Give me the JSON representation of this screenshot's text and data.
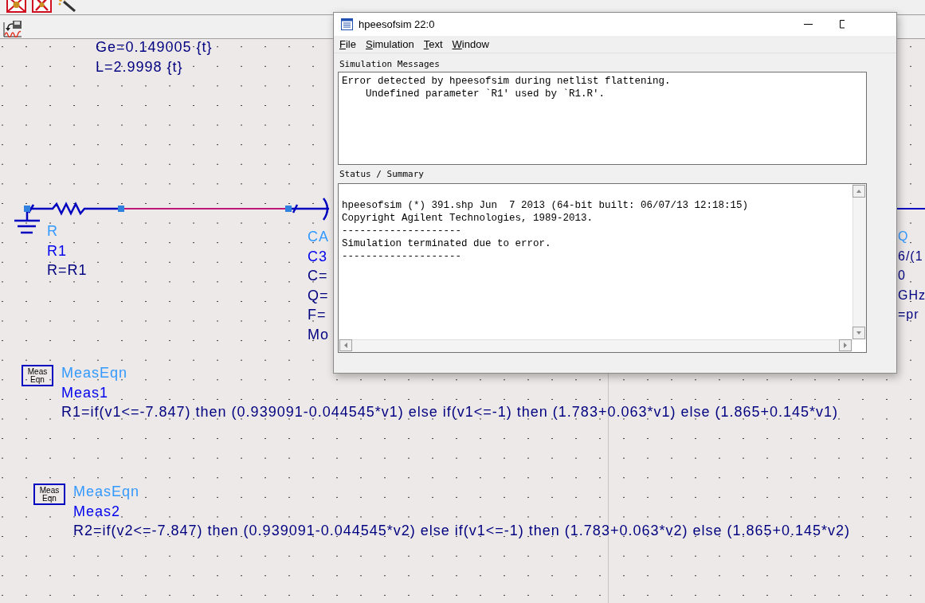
{
  "schematic": {
    "top_params": [
      "Ge=0.149005 {t}",
      "L=2.9998 {t}"
    ],
    "components": [
      {
        "type_label": "R",
        "name": "R1",
        "params": [
          "R=R1"
        ]
      },
      {
        "type_label": "CA",
        "name": "C3",
        "params": [
          "C=",
          "Q=",
          "F=",
          "Mo"
        ]
      },
      {
        "type_label": "Q",
        "params": [
          "6/(1",
          "0",
          "GHz",
          "=pr"
        ]
      }
    ],
    "equations": [
      {
        "icon_lines": [
          "Meas",
          "Eqn"
        ],
        "type_label": "MeasEqn",
        "name": "Meas1",
        "expression": "R1=if(v1<=-7.847) then (0.939091-0.044545*v1) else if(v1<=-1) then (1.783+0.063*v1) else (1.865+0.145*v1)"
      },
      {
        "icon_lines": [
          "Meas",
          "Eqn"
        ],
        "type_label": "MeasEqn",
        "name": "Meas2",
        "expression": "R2=if(v2<=-7.847) then (0.939091-0.044545*v2) else if(v1<=-1) then (1.783+0.063*v2) else (1.865+0.145*v2)"
      }
    ]
  },
  "window": {
    "title": "hpeesofsim 22:0",
    "menu": [
      "File",
      "Simulation",
      "Text",
      "Window"
    ],
    "messages_label": "Simulation Messages",
    "messages": [
      "Error detected by hpeesofsim during netlist flattening.",
      "    Undefined parameter `R1' used by `R1.R'."
    ],
    "status_label": "Status / Summary",
    "status": [
      "hpeesofsim (*) 391.shp Jun  7 2013 (64-bit built: 06/07/13 12:18:15)",
      "Copyright Agilent Technologies, 1989-2013.",
      "--------------------",
      "Simulation terminated due to error.",
      "--------------------"
    ]
  }
}
